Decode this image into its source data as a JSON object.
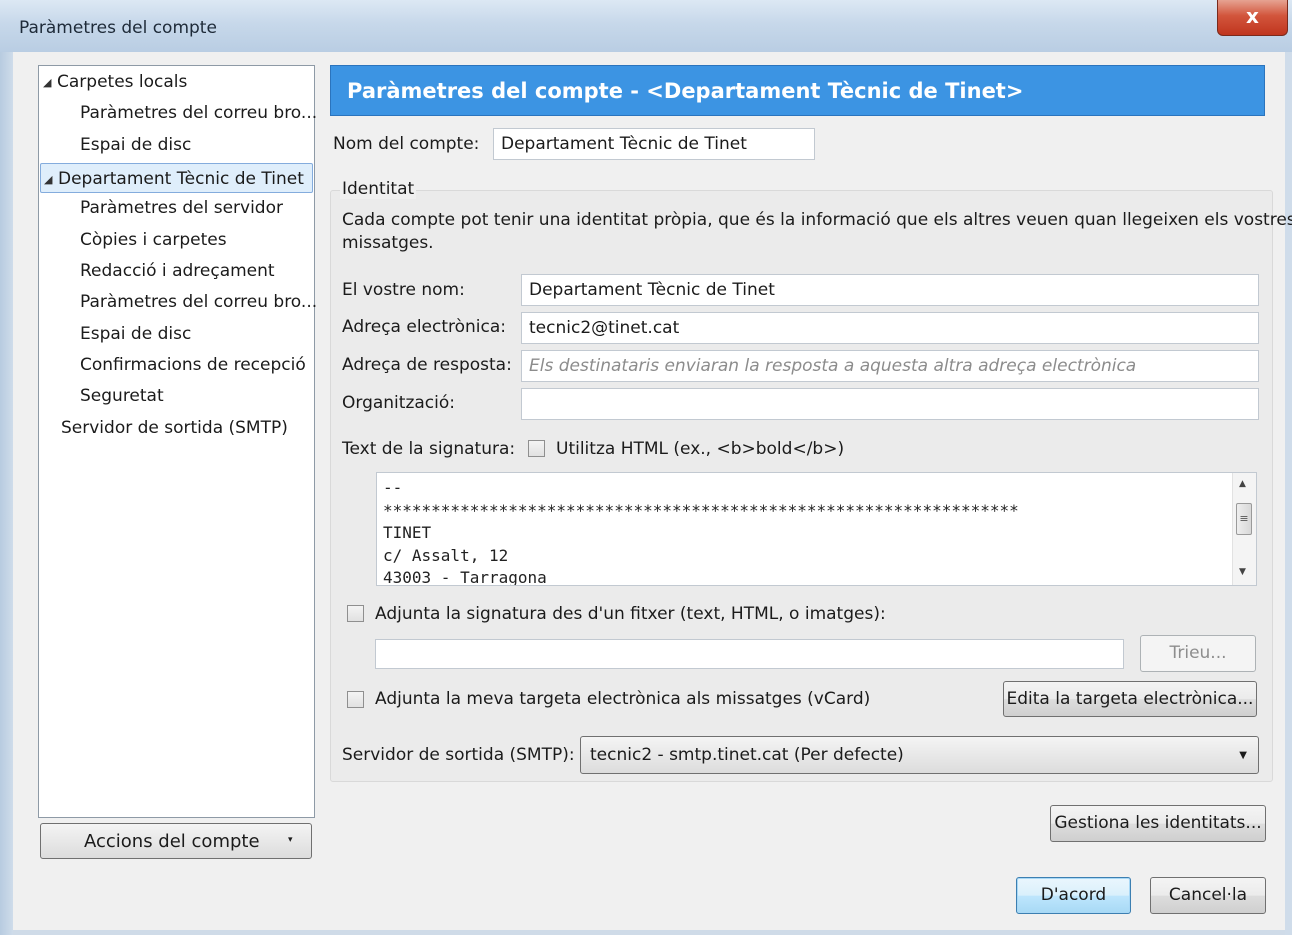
{
  "window": {
    "title": "Paràmetres del compte",
    "close_label": "x"
  },
  "tree": {
    "items": [
      {
        "label": "Carpetes locals",
        "level": 0,
        "expanded": true
      },
      {
        "label": "Paràmetres del correu bro...",
        "level": 1
      },
      {
        "label": "Espai de disc",
        "level": 1
      },
      {
        "label": "Departament Tècnic de Tinet",
        "level": 0,
        "expanded": true,
        "selected": true
      },
      {
        "label": "Paràmetres del servidor",
        "level": 1
      },
      {
        "label": "Còpies i carpetes",
        "level": 1
      },
      {
        "label": "Redacció i adreçament",
        "level": 1
      },
      {
        "label": "Paràmetres del correu bro...",
        "level": 1
      },
      {
        "label": "Espai de disc",
        "level": 1
      },
      {
        "label": "Confirmacions de recepció",
        "level": 1
      },
      {
        "label": "Seguretat",
        "level": 1
      },
      {
        "label": "Servidor de sortida (SMTP)",
        "level": 0
      }
    ],
    "expand_glyph": "◢"
  },
  "account_actions": {
    "label": "Accions del compte",
    "arrow": "▾"
  },
  "header": {
    "title": "Paràmetres del compte - <Departament Tècnic de Tinet>",
    "color": "#3c94e3"
  },
  "account_name": {
    "label": "Nom del compte:",
    "value": "Departament Tècnic de Tinet"
  },
  "identity": {
    "group_title": "Identitat",
    "description_line1": "Cada compte pot tenir una identitat pròpia, que és la informació que els altres veuen quan llegeixen els vostres",
    "description_line2": "missatges.",
    "your_name": {
      "label": "El vostre nom:",
      "value": "Departament Tècnic de Tinet"
    },
    "email": {
      "label": "Adreça electrònica:",
      "value": "tecnic2@tinet.cat"
    },
    "reply_to": {
      "label": "Adreça de resposta:",
      "placeholder": "Els destinataris enviaran la resposta a aquesta altra adreça electrònica"
    },
    "organization": {
      "label": "Organització:",
      "value": ""
    },
    "signature": {
      "label": "Text de la signatura:",
      "use_html_label": "Utilitza HTML (ex., <b>bold</b>)",
      "use_html_checked": false,
      "lines": [
        "--",
        "******************************************************************",
        "TINET",
        "c/ Assalt, 12",
        "43003 - Tarragona"
      ],
      "scroll_glyph": "≡"
    },
    "attach_signature_file": {
      "label": "Adjunta la signatura des d'un fitxer (text, HTML, o imatges):",
      "checked": false,
      "path": "",
      "browse_label": "Trieu..."
    },
    "attach_vcard": {
      "label": "Adjunta la meva targeta electrònica als missatges (vCard)",
      "checked": false,
      "edit_label": "Edita la targeta electrònica..."
    },
    "smtp": {
      "label": "Servidor de sortida (SMTP):",
      "value": "tecnic2 - smtp.tinet.cat (Per defecte)"
    }
  },
  "buttons": {
    "manage_identities": "Gestiona les identitats...",
    "ok": "D'acord",
    "cancel": "Cancel·la"
  }
}
